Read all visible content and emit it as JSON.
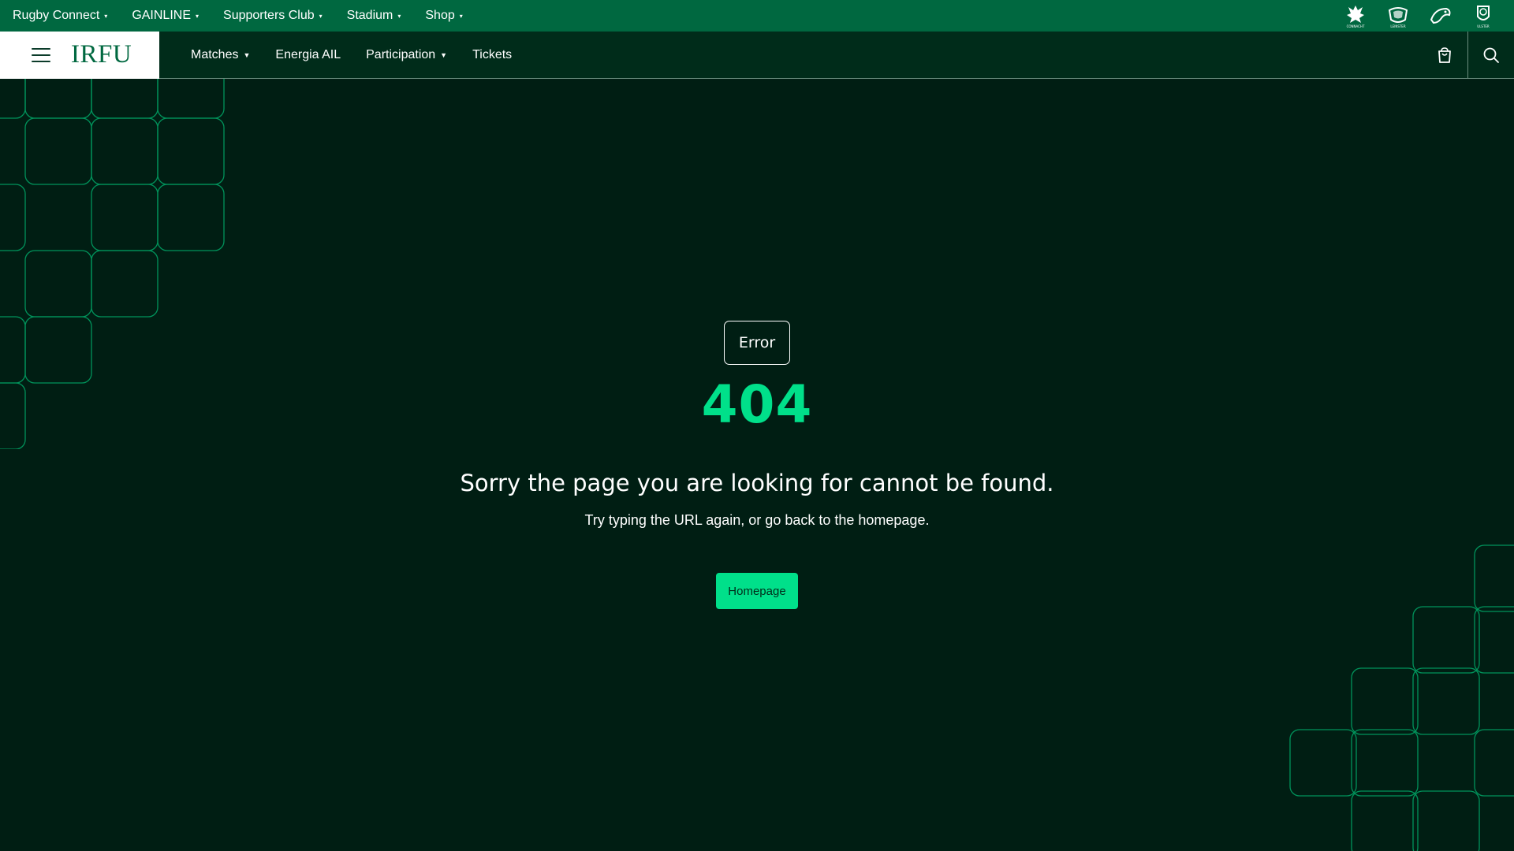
{
  "utility_bar": {
    "items": [
      {
        "label": "Rugby Connect"
      },
      {
        "label": "GAINLINE"
      },
      {
        "label": "Supporters Club"
      },
      {
        "label": "Stadium"
      },
      {
        "label": "Shop"
      }
    ],
    "province_logos": [
      {
        "name": "connacht-logo",
        "label": "CONNACHT"
      },
      {
        "name": "leinster-logo",
        "label": "LEINSTER"
      },
      {
        "name": "munster-logo",
        "label": ""
      },
      {
        "name": "ulster-logo",
        "label": "ULSTER"
      }
    ]
  },
  "main_bar": {
    "brand": "IRFU",
    "nav": [
      {
        "label": "Matches",
        "has_dropdown": true
      },
      {
        "label": "Energia AIL",
        "has_dropdown": false
      },
      {
        "label": "Participation",
        "has_dropdown": true
      },
      {
        "label": "Tickets",
        "has_dropdown": false
      }
    ],
    "icons": {
      "menu": "hamburger-icon",
      "cart": "shopping-bag-icon",
      "search": "search-icon"
    }
  },
  "error": {
    "badge": "Error",
    "code": "404",
    "heading": "Sorry the page you are looking for cannot be found.",
    "subtext": "Try typing the URL again, or go back to the homepage.",
    "button": "Homepage"
  },
  "colors": {
    "utility_bg": "#006840",
    "nav_bg": "#002c1a",
    "page_bg": "#001e13",
    "accent": "#00e08a",
    "pattern_stroke": "#00a868"
  }
}
